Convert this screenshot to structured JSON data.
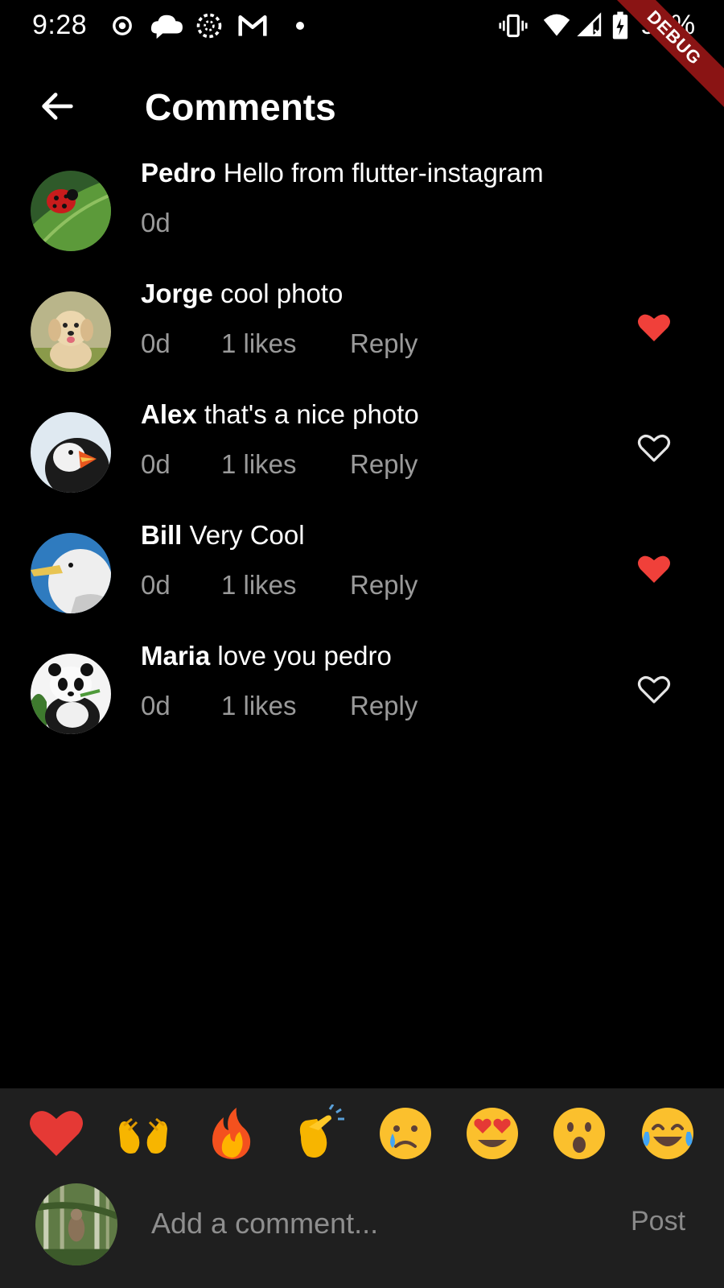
{
  "status_bar": {
    "time": "9:28",
    "battery": "91%",
    "icons": [
      "target-icon",
      "cloud-chat-icon",
      "dotted-circle-icon",
      "gmail-icon",
      "vibrate-icon",
      "wifi-icon",
      "signal-icon",
      "battery-charging-icon"
    ],
    "debug_label": "DEBUG"
  },
  "app_bar": {
    "back_icon": "arrow-left-icon",
    "title": "Comments"
  },
  "comments": [
    {
      "user": "Pedro",
      "text": " Hello from flutter-instagram",
      "time": "0d",
      "likes": "",
      "reply": "",
      "liked": null,
      "avatar": "ladybug"
    },
    {
      "user": "Jorge",
      "text": " cool photo",
      "time": "0d",
      "likes": "1 likes",
      "reply": "Reply",
      "liked": true,
      "avatar": "puppy"
    },
    {
      "user": "Alex",
      "text": " that's a nice photo",
      "time": "0d",
      "likes": "1 likes",
      "reply": "Reply",
      "liked": false,
      "avatar": "puffin"
    },
    {
      "user": "Bill",
      "text": " Very Cool",
      "time": "0d",
      "likes": "1 likes",
      "reply": "Reply",
      "liked": true,
      "avatar": "seagull"
    },
    {
      "user": "Maria",
      "text": " love you pedro",
      "time": "0d",
      "likes": "1 likes",
      "reply": "Reply",
      "liked": false,
      "avatar": "panda"
    }
  ],
  "reactions": [
    "heart",
    "raising-hands",
    "fire",
    "clapping-hands",
    "crying-face",
    "heart-eyes",
    "surprised-face",
    "tears-of-joy"
  ],
  "composer": {
    "placeholder": "Add a comment...",
    "post_label": "Post"
  },
  "colors": {
    "background": "#000000",
    "panel": "#1f1f1f",
    "like_red": "#f0403a",
    "muted_text": "#9a9a9a"
  }
}
